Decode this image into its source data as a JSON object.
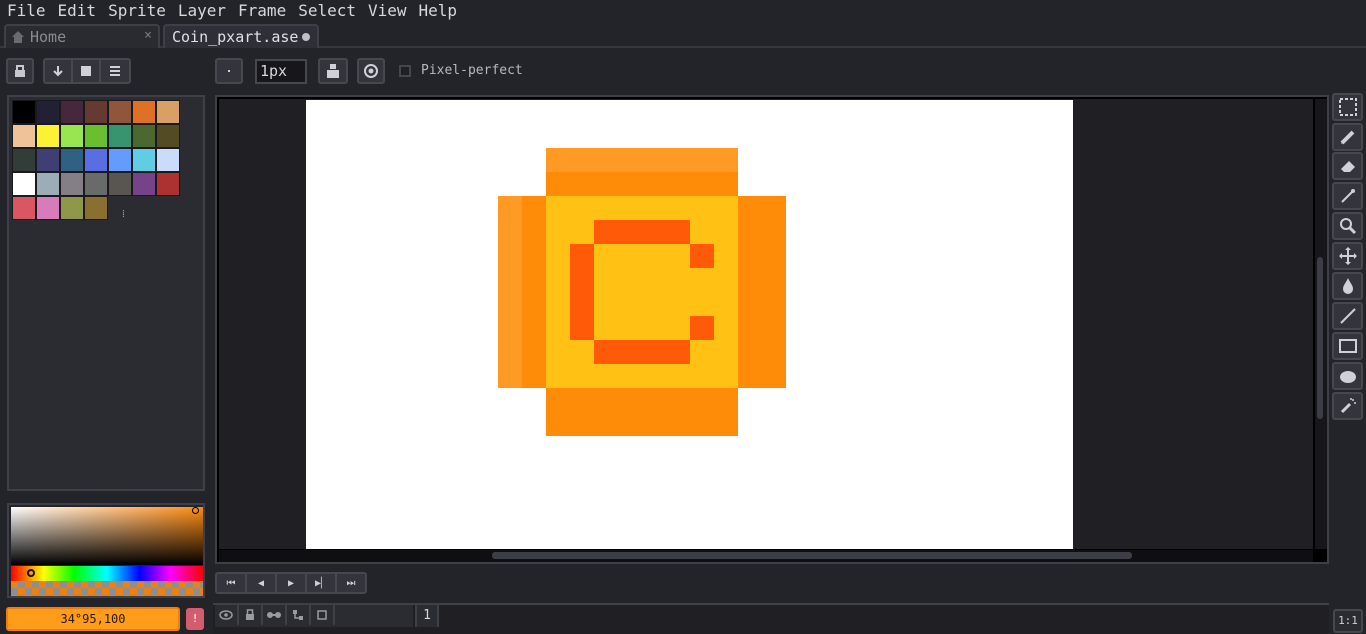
{
  "menu": [
    "File",
    "Edit",
    "Sprite",
    "Layer",
    "Frame",
    "Select",
    "View",
    "Help"
  ],
  "tabs": {
    "home": {
      "label": "Home",
      "close": "×"
    },
    "file": {
      "label": "Coin_pxart.ase"
    }
  },
  "toolbar": {
    "brush_size": "1px",
    "pixel_perfect_label": "Pixel-perfect"
  },
  "palette": {
    "colors": [
      "#000000",
      "#222034",
      "#45283c",
      "#663931",
      "#8f563b",
      "#df7126",
      "#d9a066",
      "#eec39a",
      "#fbf236",
      "#99e550",
      "#6abe30",
      "#37946e",
      "#4b692f",
      "#524b24",
      "#323c39",
      "#3f3f74",
      "#306082",
      "#5b6ee1",
      "#639bff",
      "#5fcde4",
      "#cbdbfc",
      "#ffffff",
      "#9badb7",
      "#847e87",
      "#696a6a",
      "#595652",
      "#76428a",
      "#ac3232",
      "#d95763",
      "#d77bba",
      "#8f974a",
      "#8a6f30"
    ],
    "more_glyph": "⁞"
  },
  "color": {
    "value_text": "34°95,100",
    "warning_glyph": "!"
  },
  "playback": [
    "⏮",
    "◀",
    "▶",
    "▶▏",
    "⏭"
  ],
  "timeline": {
    "frame_number": "1"
  },
  "zoom_label": "1:1"
}
